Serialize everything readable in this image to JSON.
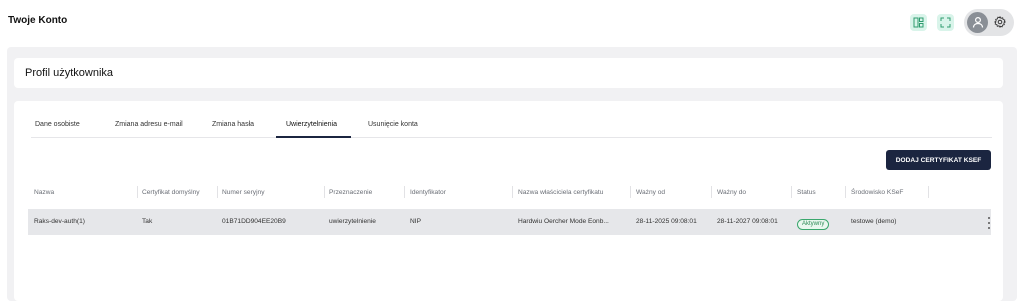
{
  "app": {
    "title": "Twoje Konto"
  },
  "profile": {
    "title": "Profil użytkownika"
  },
  "tabs": [
    {
      "label": "Dane osobiste",
      "active": false
    },
    {
      "label": "Zmiana adresu e-mail",
      "active": false
    },
    {
      "label": "Zmiana hasła",
      "active": false
    },
    {
      "label": "Uwierzytelnienia",
      "active": true
    },
    {
      "label": "Usunięcie konta",
      "active": false
    }
  ],
  "actions": {
    "add_certificate": "DODAJ CERTYFIKAT KSEF"
  },
  "table": {
    "headers": [
      "Nazwa",
      "Certyfikat domyślny",
      "Numer seryjny",
      "Przeznaczenie",
      "Identyfikator",
      "Nazwa właściciela certyfikatu",
      "Ważny od",
      "Ważny do",
      "Status",
      "Środowisko KSeF"
    ],
    "rows": [
      {
        "name": "Raks-dev-auth(1)",
        "default": "Tak",
        "serial": "01B71DD904EE20B9",
        "purpose": "uwierzytelnienie",
        "identifier": "NIP",
        "owner": "Hardwiu Oercher Mode Eonb...",
        "valid_from": "28-11-2025 09:08:01",
        "valid_to": "28-11-2027 09:08:01",
        "status": "Aktywny",
        "environment": "testowe (demo)"
      }
    ]
  },
  "icons": {
    "layout": "layout-icon",
    "expand": "expand-icon",
    "user": "user-icon",
    "settings": "gear-icon",
    "row_menu": "more-vertical-icon"
  },
  "colors": {
    "accent": "#1b2540",
    "status_active": "#2e8b57",
    "icon_bg": "#d9f4ea"
  }
}
